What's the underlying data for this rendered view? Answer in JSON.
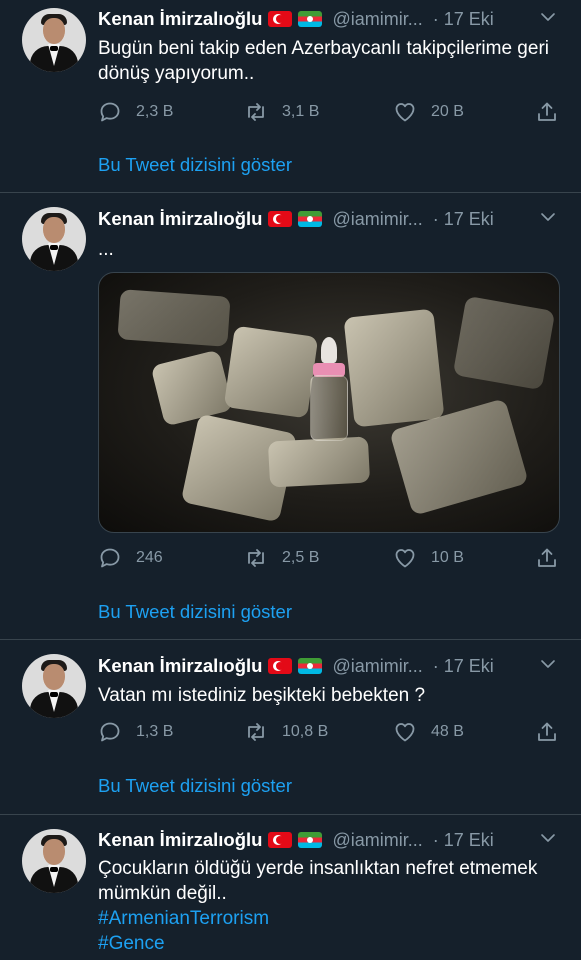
{
  "colors": {
    "background": "#15202b",
    "text": "#ffffff",
    "secondary": "#8899a6",
    "accent": "#1da1f2",
    "divider": "#38444d"
  },
  "thread_label": "Bu Tweet dizisini göster",
  "tweets": [
    {
      "name": "Kenan İmirzalıoğlu",
      "flags": [
        "flag-turkey-icon",
        "flag-azerbaijan-icon"
      ],
      "handle": "@iamimir...",
      "date": "· 17 Eki",
      "text": "Bugün beni takip eden Azerbaycanlı takipçilerime geri dönüş yapıyorum..",
      "replies": "2,3 B",
      "retweets": "3,1 B",
      "likes": "20 B"
    },
    {
      "name": "Kenan İmirzalıoğlu",
      "flags": [
        "flag-turkey-icon",
        "flag-azerbaijan-icon"
      ],
      "handle": "@iamimir...",
      "date": "· 17 Eki",
      "text": "...",
      "replies": "246",
      "retweets": "2,5 B",
      "likes": "10 B"
    },
    {
      "name": "Kenan İmirzalıoğlu",
      "flags": [
        "flag-turkey-icon",
        "flag-azerbaijan-icon"
      ],
      "handle": "@iamimir...",
      "date": "· 17 Eki",
      "text": "Vatan mı istediniz beşikteki bebekten ?",
      "replies": "1,3 B",
      "retweets": "10,8 B",
      "likes": "48 B"
    },
    {
      "name": "Kenan İmirzalıoğlu",
      "flags": [
        "flag-turkey-icon",
        "flag-azerbaijan-icon"
      ],
      "handle": "@iamimir...",
      "date": "· 17 Eki",
      "text": "Çocukların öldüğü yerde insanlıktan nefret etmemek mümkün değil..",
      "hashtags": [
        "#ArmenianTerrorism",
        "#Gence"
      ]
    }
  ]
}
